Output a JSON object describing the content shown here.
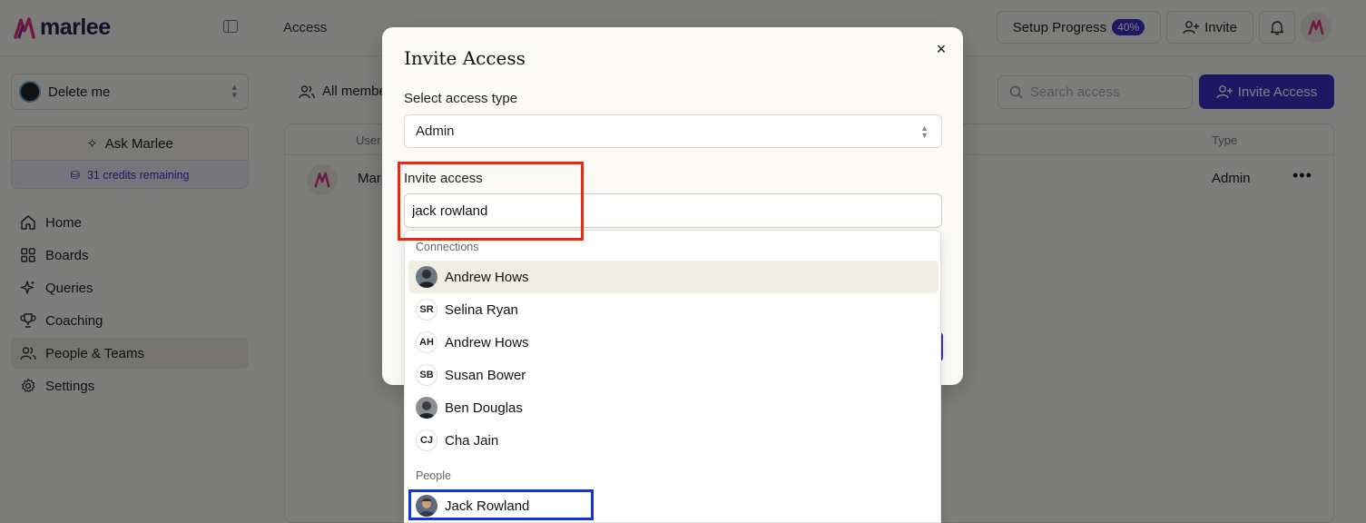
{
  "app": {
    "logo_text": "marlee",
    "breadcrumb": "Access"
  },
  "topbar": {
    "setup_label": "Setup Progress",
    "setup_percent": "40%",
    "invite_label": "Invite"
  },
  "sidebar": {
    "workspace": "Delete me",
    "ask_label": "Ask Marlee",
    "credits": "31 credits remaining",
    "nav": [
      {
        "label": "Home",
        "icon": "home-icon"
      },
      {
        "label": "Boards",
        "icon": "grid-icon"
      },
      {
        "label": "Queries",
        "icon": "sparkle-icon"
      },
      {
        "label": "Coaching",
        "icon": "trophy-icon"
      },
      {
        "label": "People & Teams",
        "icon": "people-icon",
        "active": true
      },
      {
        "label": "Settings",
        "icon": "gear-icon"
      }
    ]
  },
  "main": {
    "tab_label": "All membe",
    "search_placeholder": "Search access",
    "invite_access_label": "Invite Access",
    "table": {
      "col_user": "User",
      "col_type": "Type",
      "rows": [
        {
          "name": "Marl",
          "type": "Admin"
        }
      ]
    }
  },
  "modal": {
    "title": "Invite Access",
    "select_label": "Select access type",
    "select_value": "Admin",
    "invite_label": "Invite access",
    "invite_value": "jack rowland"
  },
  "dropdown": {
    "connections_label": "Connections",
    "connections": [
      {
        "name": "Andrew Hows",
        "initials": "",
        "photo": true
      },
      {
        "name": "Selina Ryan",
        "initials": "SR"
      },
      {
        "name": "Andrew Hows",
        "initials": "AH"
      },
      {
        "name": "Susan Bower",
        "initials": "SB"
      },
      {
        "name": "Ben Douglas",
        "initials": "",
        "photo": true
      },
      {
        "name": "Cha Jain",
        "initials": "CJ"
      }
    ],
    "people_label": "People",
    "people": [
      {
        "name": "Jack Rowland",
        "initials": "",
        "photo": true
      }
    ]
  },
  "colors": {
    "accent": "#3d2fc9",
    "highlight_red": "#ea2a10",
    "highlight_blue": "#1232e6"
  }
}
